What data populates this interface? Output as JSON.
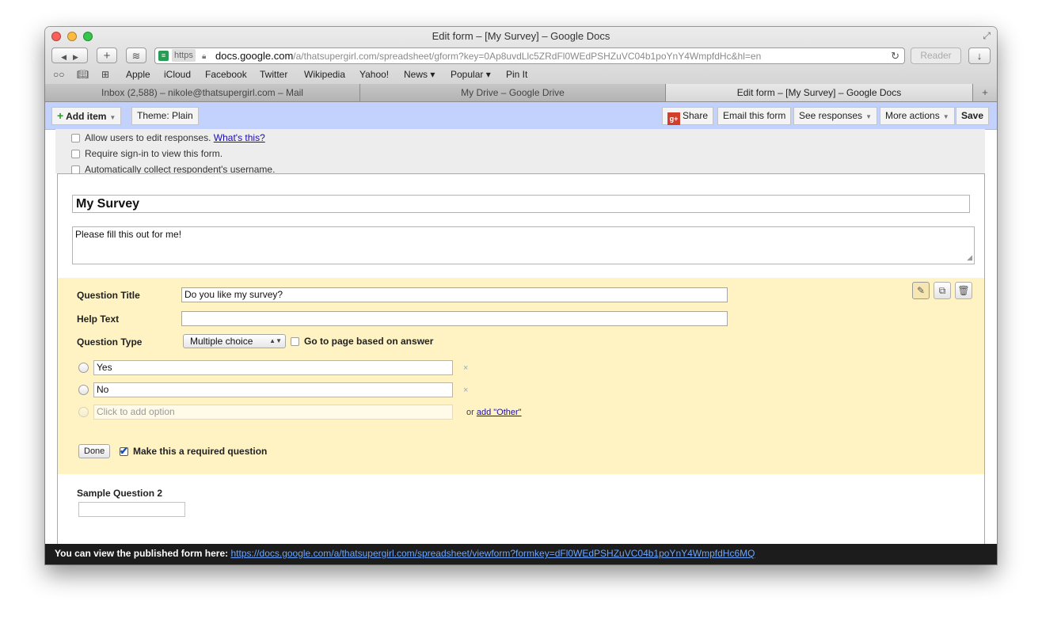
{
  "window": {
    "title": "Edit form – [My Survey] – Google Docs"
  },
  "toolbar": {
    "back_icon": "◀",
    "forward_icon": "▶",
    "new_tab_icon": "+",
    "sidebar_icon": "≋",
    "address": {
      "scheme": "https",
      "host": "docs.google.com",
      "path": "/a/thatsupergirl.com/spreadsheet/gform?key=0Ap8uvdLlc5ZRdFl0WEdPSHZuVC04b1poYnY4WmpfdHc&hl=en"
    },
    "reader_label": "Reader",
    "download_icon": "↓"
  },
  "bookmarks": {
    "items": [
      "Apple",
      "iCloud",
      "Facebook",
      "Twitter",
      "Wikipedia",
      "Yahoo!",
      "News ▾",
      "Popular ▾",
      "Pin It"
    ]
  },
  "tabs": [
    {
      "label": "Inbox (2,588) – nikole@thatsupergirl.com – Mail",
      "active": false
    },
    {
      "label": "My Drive – Google Drive",
      "active": false
    },
    {
      "label": "Edit form – [My Survey] – Google Docs",
      "active": true
    }
  ],
  "appbar": {
    "add_item": "Add item",
    "theme": "Theme:  Plain",
    "share": "Share",
    "email_form": "Email this form",
    "see_responses": "See responses",
    "more_actions": "More actions",
    "save": "Save"
  },
  "settings": {
    "allow_edit": "Allow users to edit responses.",
    "whats_this": "What's this?",
    "require_signin": "Require sign-in to view this form.",
    "collect_username": "Automatically collect respondent's username."
  },
  "form": {
    "title": "My Survey",
    "description": "Please fill this out for me!"
  },
  "question": {
    "title_label": "Question Title",
    "title_value": "Do you like my survey?",
    "help_label": "Help Text",
    "help_value": "",
    "type_label": "Question Type",
    "type_value": "Multiple choice",
    "goto_label": "Go to page based on answer",
    "options": [
      "Yes",
      "No"
    ],
    "add_option_placeholder": "Click to add option",
    "or_text": "or",
    "add_other": "add \"Other\"",
    "done": "Done",
    "required_label": "Make this a required question",
    "required_checked": true
  },
  "sample": {
    "label": "Sample Question 2"
  },
  "footer": {
    "text": "You can view the published form here:",
    "link": "https://docs.google.com/a/thatsupergirl.com/spreadsheet/viewform?formkey=dFl0WEdPSHZuVC04b1poYnY4WmpfdHc6MQ"
  }
}
